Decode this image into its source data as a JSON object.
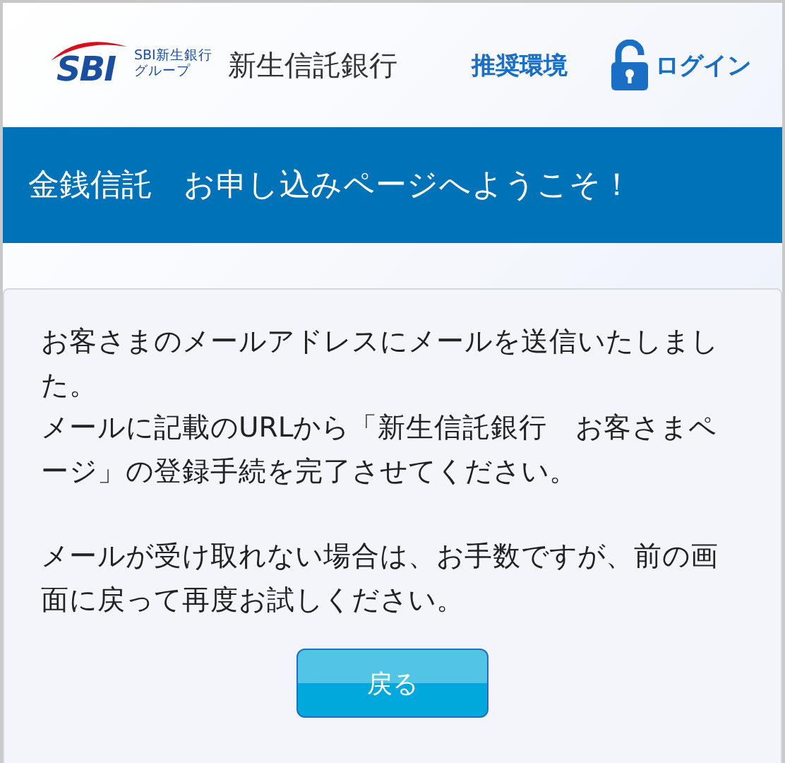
{
  "header": {
    "logo_mark": "SBI",
    "logo_group_line1": "SBI新生銀行",
    "logo_group_line2": "グループ",
    "site_name": "新生信託銀行",
    "links": [
      {
        "label": "推奨環境",
        "kind": "text"
      },
      {
        "label": "ログイン",
        "kind": "login"
      }
    ]
  },
  "banner": {
    "title": "金銭信託　お申し込みページへようこそ！"
  },
  "message": {
    "blocks": [
      [
        "お客さまのメールアドレスにメールを送信いたしました。",
        "メールに記載のURLから「新生信託銀行　お客さまページ」の登録手続を完了させてください。"
      ],
      [
        "メールが受け取れない場合は、お手数ですが、前の画面に戻って再度お試しください。"
      ]
    ],
    "button": "戻る"
  }
}
